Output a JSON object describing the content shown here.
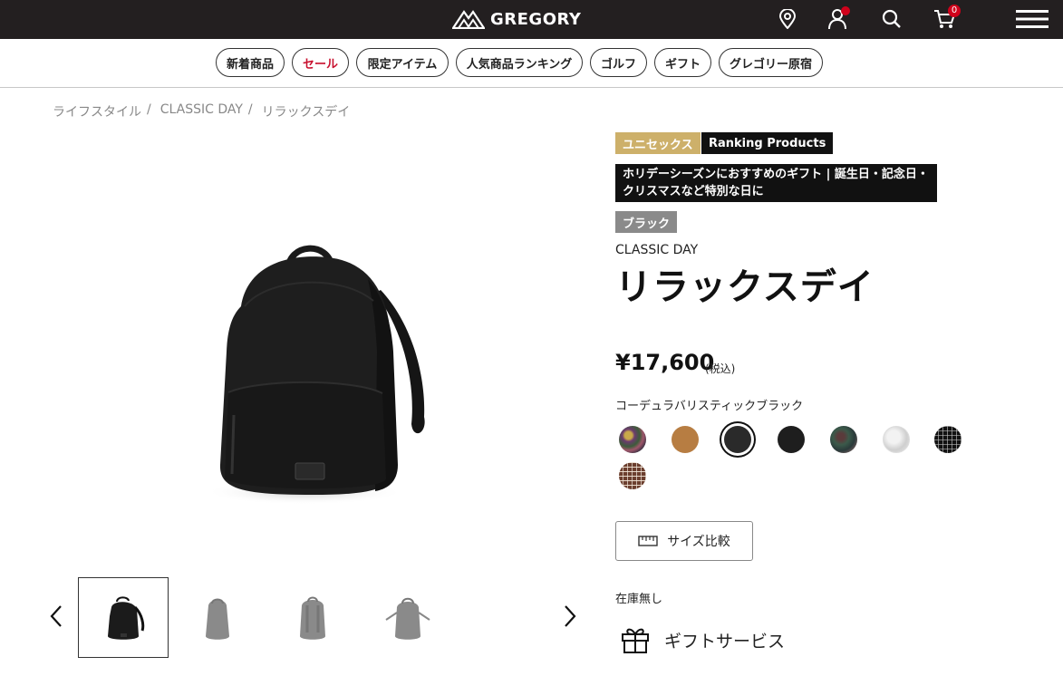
{
  "header": {
    "brand": "GREGORY",
    "cart_count": "0",
    "icons": [
      "location-pin-icon",
      "user-icon",
      "search-icon",
      "cart-icon",
      "hamburger-menu-icon"
    ]
  },
  "categories": [
    {
      "label": "新着商品"
    },
    {
      "label": "セール"
    },
    {
      "label": "限定アイテム"
    },
    {
      "label": "人気商品ランキング"
    },
    {
      "label": "ゴルフ"
    },
    {
      "label": "ギフト"
    },
    {
      "label": "グレゴリー原宿"
    }
  ],
  "breadcrumb": [
    {
      "label": "ライフスタイル"
    },
    {
      "label": "CLASSIC DAY"
    },
    {
      "label": "リラックスデイ"
    }
  ],
  "tags": {
    "unisex": "ユニセックス",
    "ranking": "Ranking Products",
    "holiday": "ホリデーシーズンにおすすめのギフト | 誕生日・記念日・クリスマスなど特別な日に",
    "color": "ブラック"
  },
  "product": {
    "series": "CLASSIC DAY",
    "name": "リラックスデイ",
    "price": "¥17,600",
    "tax_note": "(税込)",
    "color_name": "コーデュラバリスティックブラック",
    "size_compare": "サイズ比較",
    "stock": "在庫無し",
    "gift_service": "ギフトサービス"
  },
  "colors": {
    "brand_bar": "#231f20",
    "sale": "#c8102e",
    "unisex_tag": "#cdb06a"
  },
  "swatches": [
    {
      "name": "floral-multi",
      "selected": false
    },
    {
      "name": "tan",
      "selected": false
    },
    {
      "name": "cordura-ballistic-black",
      "selected": true
    },
    {
      "name": "black",
      "selected": false
    },
    {
      "name": "camo-green",
      "selected": false
    },
    {
      "name": "light-gray",
      "selected": false
    },
    {
      "name": "black-plaid",
      "selected": false
    },
    {
      "name": "brown-plaid",
      "selected": false
    }
  ]
}
